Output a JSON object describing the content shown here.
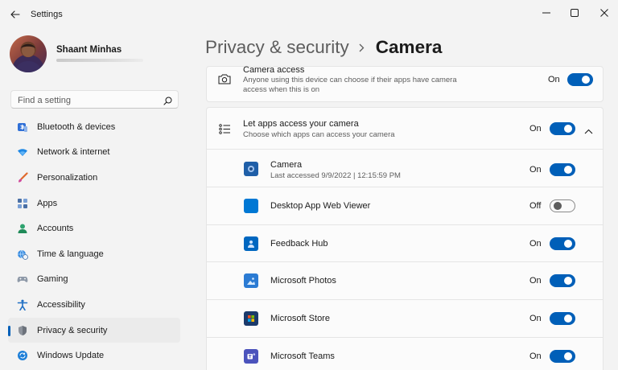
{
  "window": {
    "title": "Settings"
  },
  "profile": {
    "name": "Shaant Minhas"
  },
  "search": {
    "placeholder": "Find a setting"
  },
  "sidebar": {
    "items": [
      {
        "label": "Bluetooth & devices",
        "icon": "bluetooth-icon",
        "active": false
      },
      {
        "label": "Network & internet",
        "icon": "wifi-icon",
        "active": false
      },
      {
        "label": "Personalization",
        "icon": "brush-icon",
        "active": false
      },
      {
        "label": "Apps",
        "icon": "apps-icon",
        "active": false
      },
      {
        "label": "Accounts",
        "icon": "person-icon",
        "active": false
      },
      {
        "label": "Time & language",
        "icon": "globe-clock-icon",
        "active": false
      },
      {
        "label": "Gaming",
        "icon": "gamepad-icon",
        "active": false
      },
      {
        "label": "Accessibility",
        "icon": "accessibility-icon",
        "active": false
      },
      {
        "label": "Privacy & security",
        "icon": "shield-icon",
        "active": true
      },
      {
        "label": "Windows Update",
        "icon": "update-icon",
        "active": false
      }
    ]
  },
  "breadcrumb": {
    "parent": "Privacy & security",
    "current": "Camera"
  },
  "camera_access": {
    "title": "Camera access",
    "description": "Anyone using this device can choose if their apps have camera access when this is on",
    "state": "On",
    "on": true
  },
  "apps_section": {
    "title": "Let apps access your camera",
    "description": "Choose which apps can access your camera",
    "state": "On",
    "on": true,
    "expanded": true
  },
  "apps": [
    {
      "name": "Camera",
      "subtitle": "Last accessed 9/9/2022  |  12:15:59 PM",
      "state": "On",
      "on": true,
      "icon": "camera-app-icon",
      "color": "#1f5fa8"
    },
    {
      "name": "Desktop App Web Viewer",
      "subtitle": "",
      "state": "Off",
      "on": false,
      "icon": "web-viewer-app-icon",
      "color": "#0078d4"
    },
    {
      "name": "Feedback Hub",
      "subtitle": "",
      "state": "On",
      "on": true,
      "icon": "feedback-hub-app-icon",
      "color": "#0067c0"
    },
    {
      "name": "Microsoft Photos",
      "subtitle": "",
      "state": "On",
      "on": true,
      "icon": "photos-app-icon",
      "color": "#2b7bd3"
    },
    {
      "name": "Microsoft Store",
      "subtitle": "",
      "state": "On",
      "on": true,
      "icon": "store-app-icon",
      "color": "#1b3a6b"
    },
    {
      "name": "Microsoft Teams",
      "subtitle": "",
      "state": "On",
      "on": true,
      "icon": "teams-app-icon",
      "color": "#4b53bc"
    }
  ],
  "colors": {
    "accent": "#005fb8",
    "background": "#f3f3f3",
    "card": "#fbfbfb"
  }
}
